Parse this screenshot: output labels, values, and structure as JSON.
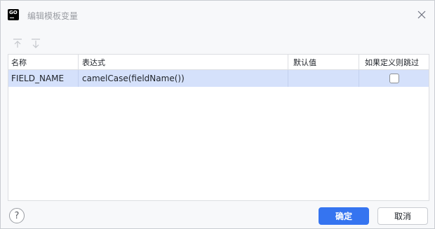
{
  "window": {
    "title": "编辑模板变量",
    "logo_text": "GO"
  },
  "toolbar": {
    "move_up_icon": "arrow-up-icon",
    "move_down_icon": "arrow-down-icon"
  },
  "table": {
    "columns": [
      "名称",
      "表达式",
      "默认值",
      "如果定义则跳过"
    ],
    "rows": [
      {
        "name": "FIELD_NAME",
        "expression": "camelCase(fieldName())",
        "default_value": "",
        "skip_if_defined": false
      }
    ]
  },
  "footer": {
    "help_label": "?",
    "ok_label": "确定",
    "cancel_label": "取消"
  },
  "colors": {
    "accent": "#3574f0",
    "selected_row": "#d5e1fb"
  }
}
